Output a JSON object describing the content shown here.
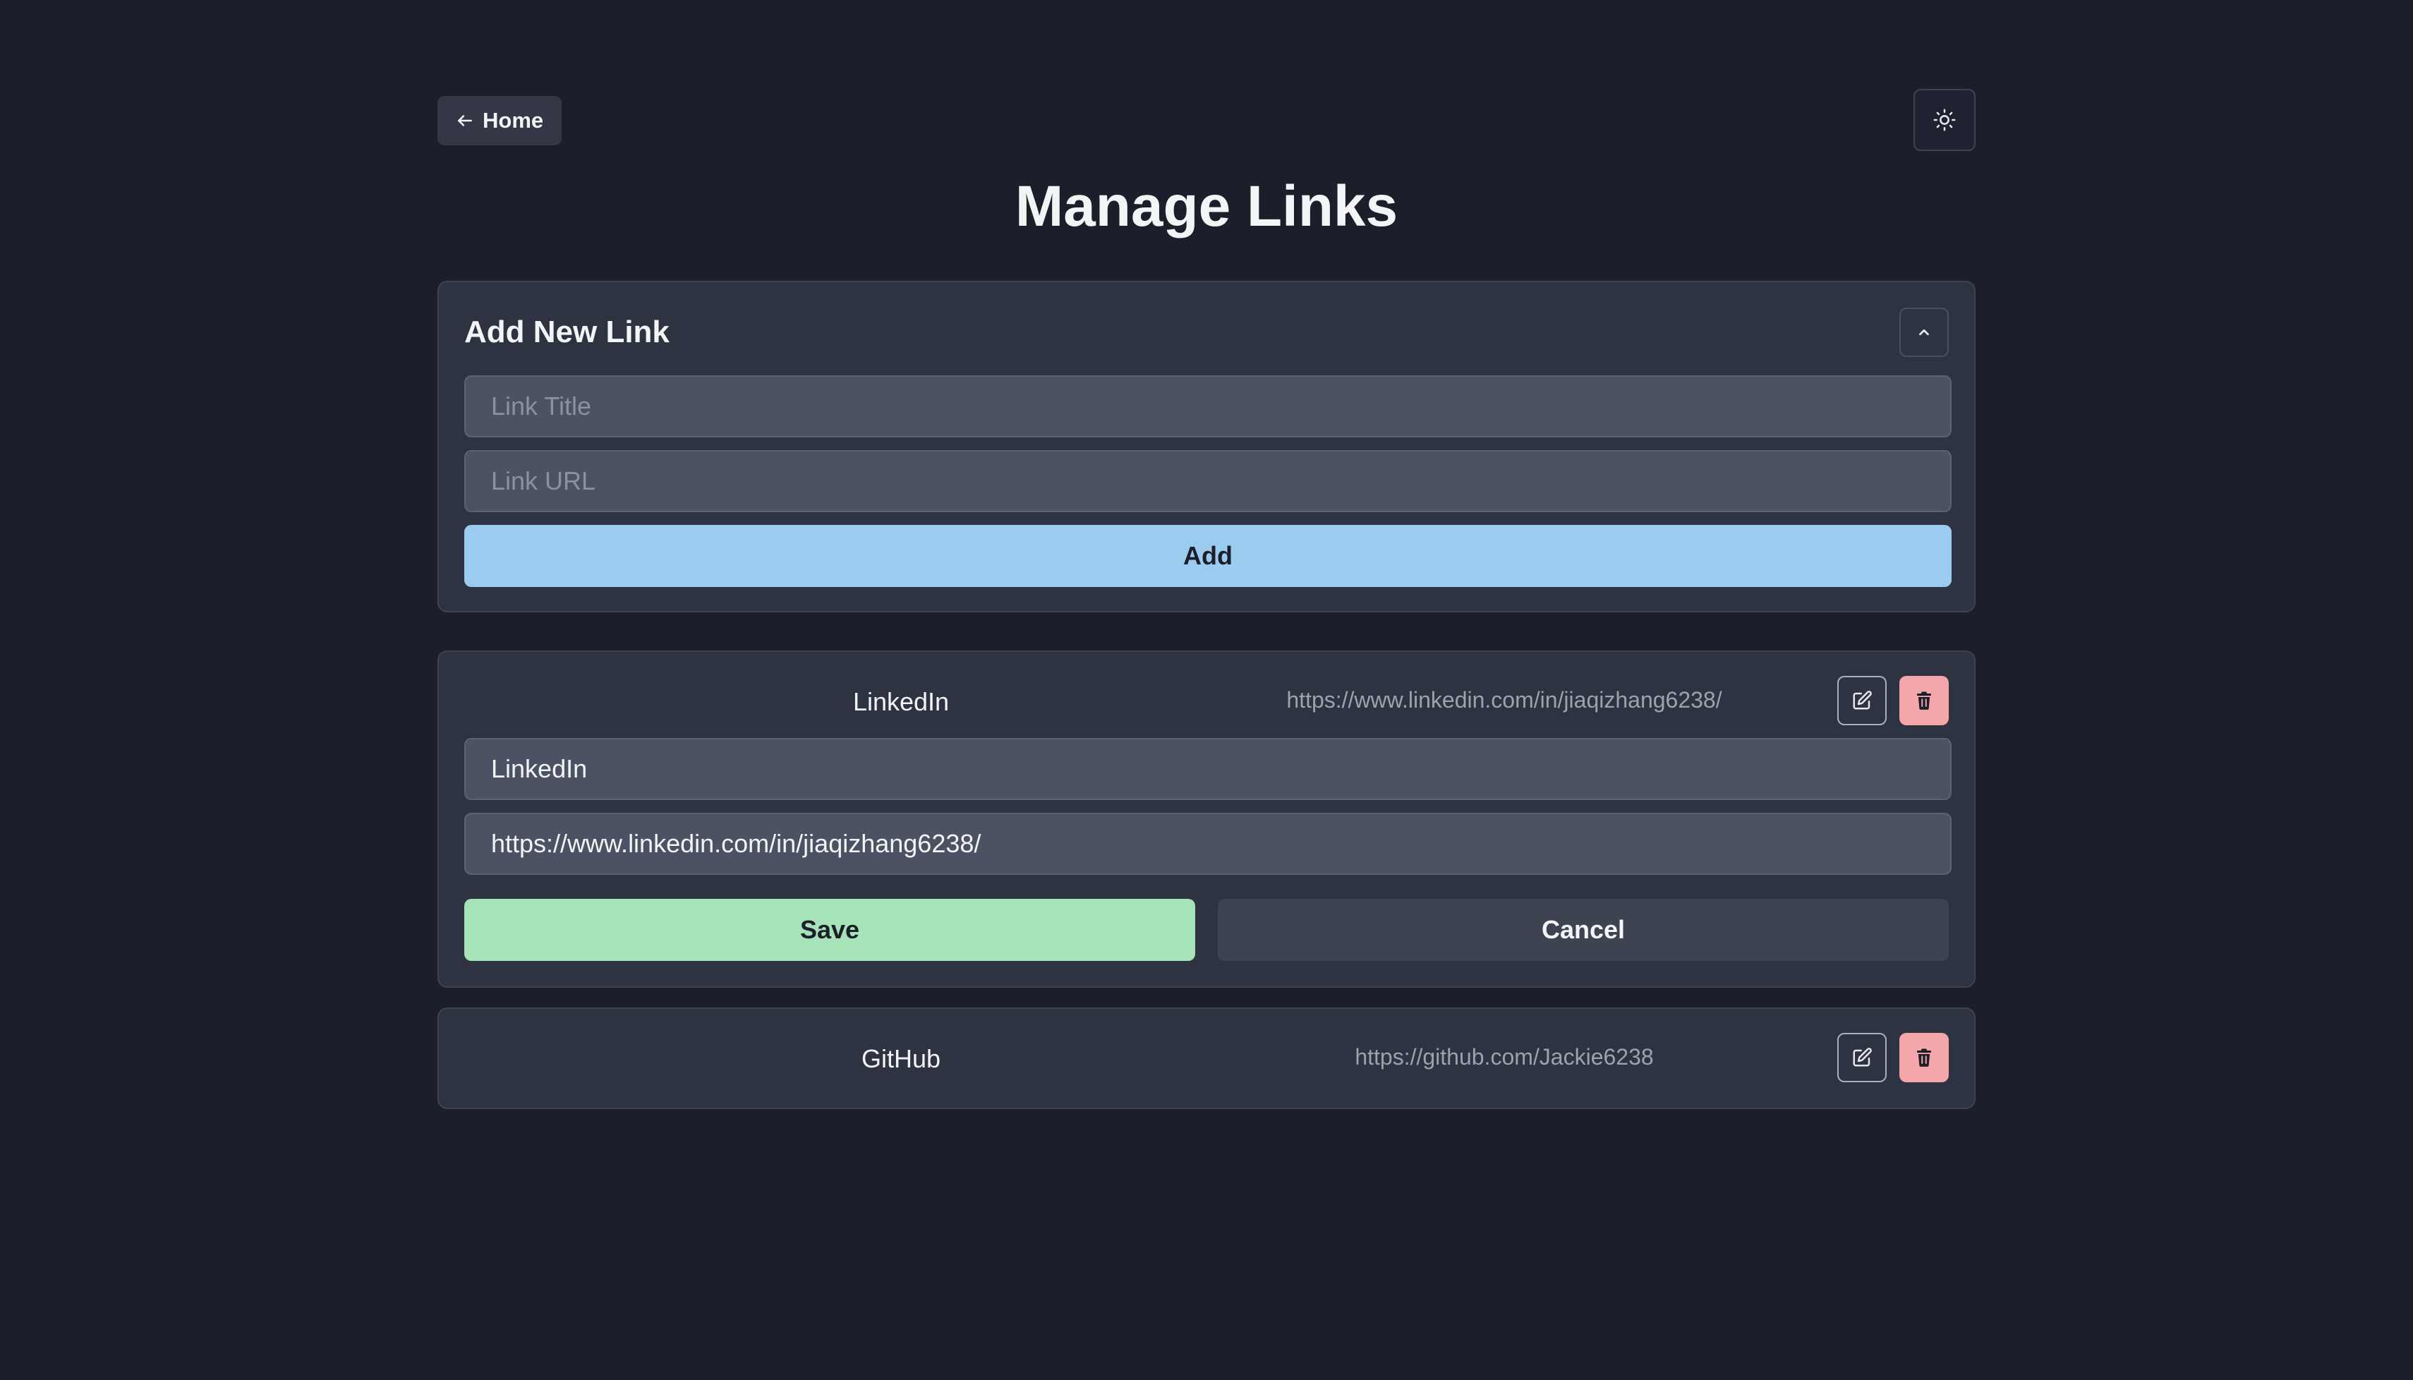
{
  "nav": {
    "home_label": "Home",
    "home_icon": "arrow-left-icon",
    "theme_icon": "sun-icon"
  },
  "page": {
    "title": "Manage Links"
  },
  "add_form": {
    "title": "Add New Link",
    "collapse_icon": "chevron-up-icon",
    "title_placeholder": "Link Title",
    "url_placeholder": "Link URL",
    "add_label": "Add"
  },
  "links": [
    {
      "name": "LinkedIn",
      "url": "https://www.linkedin.com/in/jiaqizhang6238/",
      "editing": true,
      "edit_title_value": "LinkedIn",
      "edit_url_value": "https://www.linkedin.com/in/jiaqizhang6238/",
      "save_label": "Save",
      "cancel_label": "Cancel"
    },
    {
      "name": "GitHub",
      "url": "https://github.com/Jackie6238",
      "editing": false
    }
  ],
  "colors": {
    "background": "#1c1f2a",
    "card": "#2e3341",
    "add_button": "#9ccbf0",
    "save_button": "#a7e3b8",
    "delete_button": "#f4a7ab"
  }
}
